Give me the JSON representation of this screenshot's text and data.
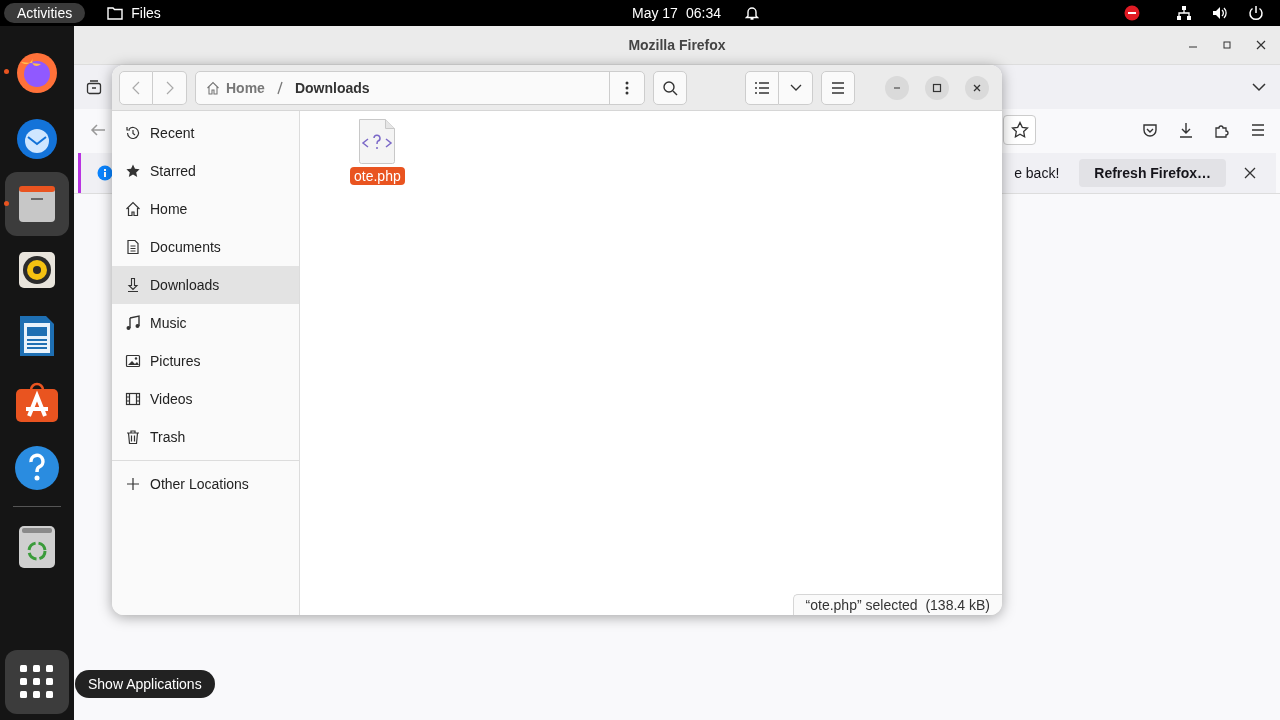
{
  "top_bar": {
    "activities": "Activities",
    "app_name": "Files",
    "date": "May 17",
    "time": "06:34"
  },
  "dock": {
    "items": [
      {
        "kind": "firefox",
        "running": true,
        "selected": false
      },
      {
        "kind": "thunderbird",
        "running": false,
        "selected": false
      },
      {
        "kind": "files",
        "running": true,
        "selected": true
      },
      {
        "kind": "rhythmbox",
        "running": false,
        "selected": false
      },
      {
        "kind": "writer",
        "running": false,
        "selected": false
      },
      {
        "kind": "appcenter",
        "running": false,
        "selected": false
      },
      {
        "kind": "help",
        "running": false,
        "selected": false
      }
    ],
    "trash": {
      "running": false,
      "selected": false
    },
    "tooltip": "Show Applications"
  },
  "firefox": {
    "title": "Mozilla Firefox",
    "notification": {
      "text": "e back!",
      "button": "Refresh Firefox…"
    }
  },
  "files": {
    "path": [
      {
        "label": "Home",
        "kind": "home"
      },
      {
        "label": "Downloads",
        "kind": "folder"
      }
    ],
    "sidebar": [
      {
        "label": "Recent",
        "kind": "recent",
        "selected": false
      },
      {
        "label": "Starred",
        "kind": "starred",
        "selected": false
      },
      {
        "label": "Home",
        "kind": "home",
        "selected": false
      },
      {
        "label": "Documents",
        "kind": "documents",
        "selected": false
      },
      {
        "label": "Downloads",
        "kind": "downloads",
        "selected": true
      },
      {
        "label": "Music",
        "kind": "music",
        "selected": false
      },
      {
        "label": "Pictures",
        "kind": "pictures",
        "selected": false
      },
      {
        "label": "Videos",
        "kind": "videos",
        "selected": false
      },
      {
        "label": "Trash",
        "kind": "trash",
        "selected": false
      }
    ],
    "other_locations": "Other Locations",
    "items": [
      {
        "name": "ote.php",
        "selected": true
      }
    ],
    "status": "“ote.php” selected  (138.4 kB)"
  }
}
